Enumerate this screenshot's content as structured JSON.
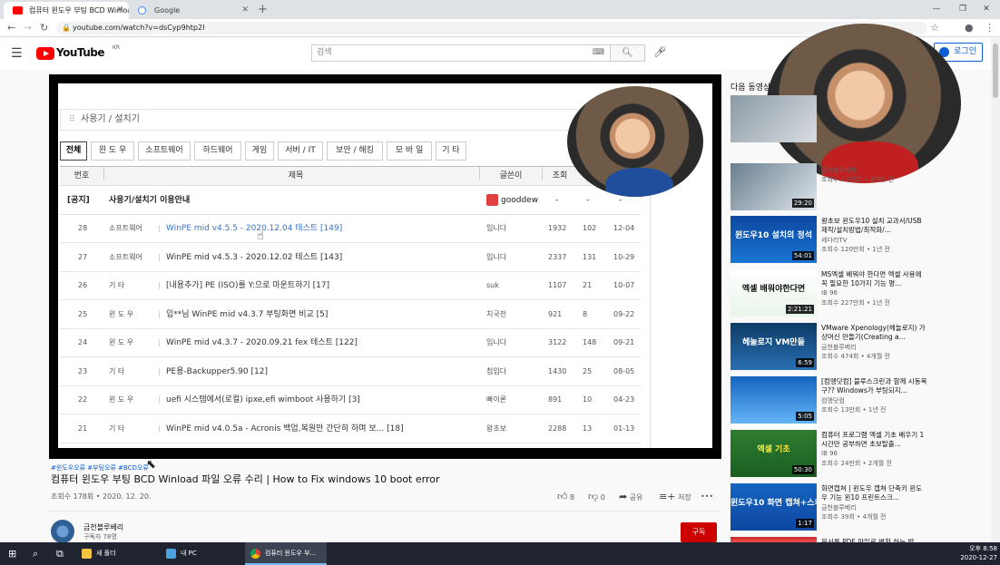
{
  "browser": {
    "tabs": [
      {
        "label": "컴퓨터 윈도우 부팅 BCD Winload",
        "active": true
      },
      {
        "label": "Google",
        "active": false
      }
    ],
    "url": "youtube.com/watch?v=dsCyp9htp2I"
  },
  "masthead": {
    "logo_text": "YouTube",
    "region": "KR",
    "search_placeholder": "검색",
    "login_label": "로그인"
  },
  "board": {
    "section_title": "사용기 / 설치기",
    "tabs": [
      "전체",
      "윈 도 우",
      "소프트웨어",
      "하드웨어",
      "게임",
      "서버 / IT",
      "보안 / 해킹",
      "모 바 일",
      "기 타"
    ],
    "headers": {
      "num": "번호",
      "title": "제목",
      "author": "글쓴이",
      "views": "조회"
    },
    "notice": {
      "tag": "[공지]",
      "title": "사용기/설치기 이용안내",
      "author": "gooddew",
      "views": "-",
      "likes": "-",
      "date": "-"
    },
    "rows": [
      {
        "num": "28",
        "cat": "소프트웨어",
        "title": "WinPE mid v4.5.5 - 2020.12.04 테스트 [149]",
        "author": "입니다",
        "views": "1932",
        "likes": "102",
        "date": "12-04"
      },
      {
        "num": "27",
        "cat": "소프트웨어",
        "title": "WinPE mid v4.5.3 - 2020.12.02 테스트 [143]",
        "author": "입니다",
        "views": "2337",
        "likes": "131",
        "date": "10-29"
      },
      {
        "num": "26",
        "cat": "기 타",
        "title": "[내용추가] PE (ISO)를 Y:으로 마운트하기 [17]",
        "author": "suk",
        "views": "1107",
        "likes": "21",
        "date": "10-07"
      },
      {
        "num": "25",
        "cat": "윈 도 우",
        "title": "입**님 WinPE mid v4.3.7 부팅화면 비교 [5]",
        "author": "치국천",
        "views": "921",
        "likes": "8",
        "date": "09-22"
      },
      {
        "num": "24",
        "cat": "윈 도 우",
        "title": "WinPE mid v4.3.7 - 2020.09.21 fex 테스트 [122]",
        "author": "입니다",
        "views": "3122",
        "likes": "148",
        "date": "09-21"
      },
      {
        "num": "23",
        "cat": "기 타",
        "title": "PE용-Backupper5.90 [12]",
        "author": "첨입다",
        "views": "1430",
        "likes": "25",
        "date": "08-05"
      },
      {
        "num": "22",
        "cat": "윈 도 우",
        "title": "uefi 시스템에서(로컬) ipxe,efi wimboot 사용하기 [3]",
        "author": "빠이론",
        "views": "891",
        "likes": "10",
        "date": "04-23"
      },
      {
        "num": "21",
        "cat": "기 타",
        "title": "WinPE mid v4.0.5a - Acronis 백업,복원만 간단히 하며 보... [18]",
        "author": "왕초보",
        "views": "2288",
        "likes": "13",
        "date": "01-13"
      }
    ]
  },
  "video": {
    "hashtags": "#윈도우오류 #부팅오류 #BCD오류",
    "title": "컴퓨터 윈도우 부팅 BCD Winload 파일 오류 수리 | How to Fix windows 10 boot error",
    "meta": "조회수 178회 • 2020. 12. 20.",
    "likes": "8",
    "dislikes": "0",
    "share_label": "공유",
    "save_label": "저장",
    "more": "•••"
  },
  "channel": {
    "name": "금천블루베리",
    "subs": "구독자 78명",
    "subscribe_label": "구독"
  },
  "sidebar": {
    "heading": "다음 동영상",
    "items": [
      {
        "title": "",
        "channel": "",
        "views": "",
        "duration": "",
        "big": ""
      },
      {
        "title": "",
        "channel": "금천블루베리",
        "views": "조회수 2.2천회 • 4개월 전",
        "duration": "29:20",
        "big": ""
      },
      {
        "title": "왕초보 윈도우10 설치 교과서/USB제작/설치방법/최적화/...",
        "channel": "세다리TV",
        "views": "조회수 120만회 • 1년 전",
        "duration": "54:01",
        "big": "윈도우10 설치의 정석"
      },
      {
        "title": "MS엑셀 배워야 한다면 엑셀 사용에 꼭 필요한 10가지 기능 명...",
        "channel": "IB 96",
        "views": "조회수 227만회 • 1년 전",
        "duration": "2:21:21",
        "big": "엑셀 배워야한다면"
      },
      {
        "title": "VMware Xpenology(헤놀로지) 가상머신 만들기(Creating a...",
        "channel": "금천블루베리",
        "views": "조회수 474회 • 4개월 전",
        "duration": "6:59",
        "big": "헤놀로지 VM만들"
      },
      {
        "title": "[컴맹닷컴] 블루스크린과 함께 시동복구?? Windows가 부팅되지...",
        "channel": "컴맹닷컴",
        "views": "조회수 13만회 • 1년 전",
        "duration": "5:05",
        "big": ""
      },
      {
        "title": "컴퓨터 프로그램 엑셀 기초 배우기 1시간만 공부하면 초보탈출...",
        "channel": "IB 96",
        "views": "조회수 24만회 • 2개월 전",
        "duration": "50:30",
        "big": "엑셀 기초"
      },
      {
        "title": "화면캡쳐 | 윈도우 캡쳐 단축키 윈도우 기능 윈10 프린트스크...",
        "channel": "금천블루베리",
        "views": "조회수 39회 • 4개월 전",
        "duration": "1:17",
        "big": "윈도우10 화면 캡쳐+스케치"
      },
      {
        "title": "문서를 PDF 파일로 변환 하는 방",
        "channel": "",
        "views": "",
        "duration": "",
        "big": ""
      }
    ]
  },
  "taskbar": {
    "items": [
      {
        "label": "새 폴더"
      },
      {
        "label": "내 PC"
      },
      {
        "label": "컴퓨터 윈도우 부..."
      }
    ],
    "time": "오후 8:58",
    "date": "2020-12-27"
  },
  "colors": {
    "yt_red": "#ff0000",
    "link_blue": "#065fd4",
    "subscribe_red": "#cc0000",
    "taskbar": "#1f2430"
  }
}
